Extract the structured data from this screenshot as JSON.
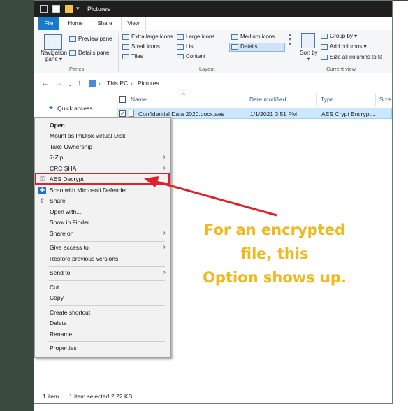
{
  "window": {
    "title": "Pictures",
    "tabs": [
      "File",
      "Home",
      "Share",
      "View"
    ]
  },
  "ribbon": {
    "panes": {
      "navigation_pane": "Navigation pane",
      "preview_pane": "Preview pane",
      "details_pane": "Details pane",
      "group_label": "Panes"
    },
    "layout": {
      "items": [
        "Extra large icons",
        "Large icons",
        "Medium icons",
        "Small icons",
        "List",
        "Details",
        "Tiles",
        "Content"
      ],
      "group_label": "Layout"
    },
    "current_view": {
      "sort_by": "Sort by",
      "group_by": "Group by",
      "add_columns": "Add columns",
      "size_all_columns": "Size all columns to fit",
      "group_label": "Current view"
    }
  },
  "address": {
    "crumbs": [
      "This PC",
      "Pictures"
    ]
  },
  "nav": {
    "quick_access": "Quick access"
  },
  "columns": [
    "Name",
    "Date modified",
    "Type",
    "Size"
  ],
  "file": {
    "name": "Confidential Data 2020.docx.aes",
    "date": "1/1/2021 3:51 PM",
    "type": "AES Crypt Encrypt..."
  },
  "context_menu": {
    "items": [
      {
        "label": "Open",
        "bold": true
      },
      {
        "label": "Mount as ImDisk Virtual Disk"
      },
      {
        "label": "Take Ownership"
      },
      {
        "label": "7-Zip",
        "submenu": true
      },
      {
        "label": "CRC SHA",
        "submenu": true
      },
      {
        "label": "AES Decrypt",
        "icon": "aes-decrypt-icon"
      },
      {
        "label": "Scan with Microsoft Defender...",
        "icon": "defender-shield-icon"
      },
      {
        "label": "Share",
        "icon": "share-icon"
      },
      {
        "label": "Open with..."
      },
      {
        "label": "Show in Finder"
      },
      {
        "label": "Share on",
        "submenu": true
      },
      {
        "label": "Give access to",
        "submenu": true
      },
      {
        "label": "Restore previous versions"
      },
      {
        "label": "Send to",
        "submenu": true
      },
      {
        "label": "Cut"
      },
      {
        "label": "Copy"
      },
      {
        "label": "Create shortcut"
      },
      {
        "label": "Delete"
      },
      {
        "label": "Rename"
      },
      {
        "label": "Properties"
      }
    ]
  },
  "status": {
    "count": "1 item",
    "selected": "1 item selected",
    "size": "2.22 KB"
  },
  "annotation": {
    "lines": [
      "For an encrypted",
      "file, this",
      "Option shows up."
    ],
    "color": "#f0b81c",
    "arrow_color": "#e0202a"
  }
}
